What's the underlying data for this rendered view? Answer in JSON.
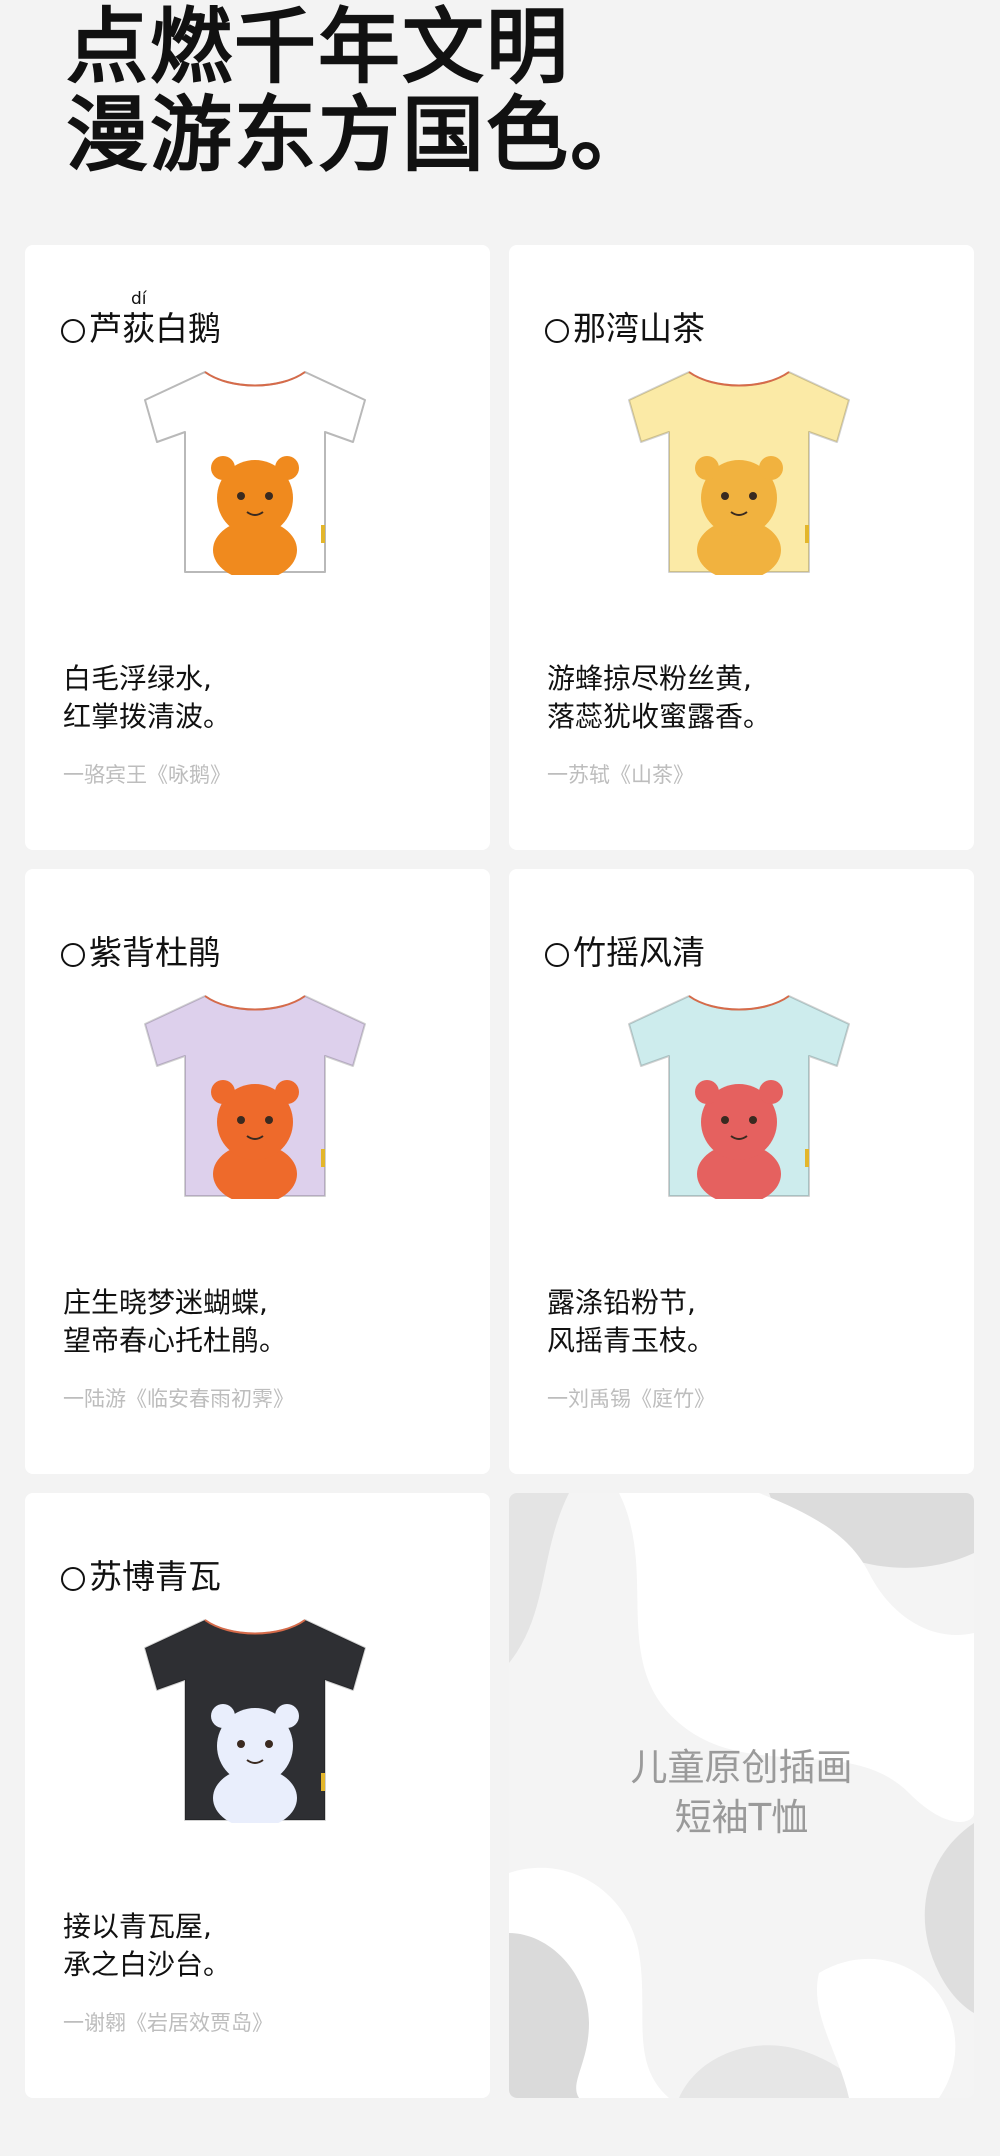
{
  "headline": {
    "line1": "点燃千年文明",
    "line2": "漫游东方国色。"
  },
  "cards": [
    {
      "title": "芦荻白鹅",
      "pinyin": "dí",
      "poem_line1": "白毛浮绿水,",
      "poem_line2": "红掌拨清波。",
      "attribution": "一骆宾王《咏鹅》",
      "shirt_color": "#ffffff",
      "creature_color": "#f08a1e"
    },
    {
      "title": "那湾山茶",
      "poem_line1": "游蜂掠尽粉丝黄,",
      "poem_line2": "落蕊犹收蜜露香。",
      "attribution": "一苏轼《山茶》",
      "shirt_color": "#fbeaa6",
      "creature_color": "#f1b23f"
    },
    {
      "title": "紫背杜鹃",
      "poem_line1": "庄生晓梦迷蝴蝶,",
      "poem_line2": "望帝春心托杜鹃。",
      "attribution": "一陆游《临安春雨初霁》",
      "shirt_color": "#ddd0ec",
      "creature_color": "#ee6a2b"
    },
    {
      "title": "竹摇风清",
      "poem_line1": "露涤铅粉节,",
      "poem_line2": "风摇青玉枝。",
      "attribution": "一刘禹锡《庭竹》",
      "shirt_color": "#cdeced",
      "creature_color": "#e5615f"
    },
    {
      "title": "苏博青瓦",
      "poem_line1": "接以青瓦屋,",
      "poem_line2": "承之白沙台。",
      "attribution": "一谢翱《岩居效贾岛》",
      "shirt_color": "#2e2f33",
      "creature_color": "#e9eefc"
    }
  ],
  "promo": {
    "line1": "儿童原创插画",
    "line2": "短袖T恤"
  }
}
